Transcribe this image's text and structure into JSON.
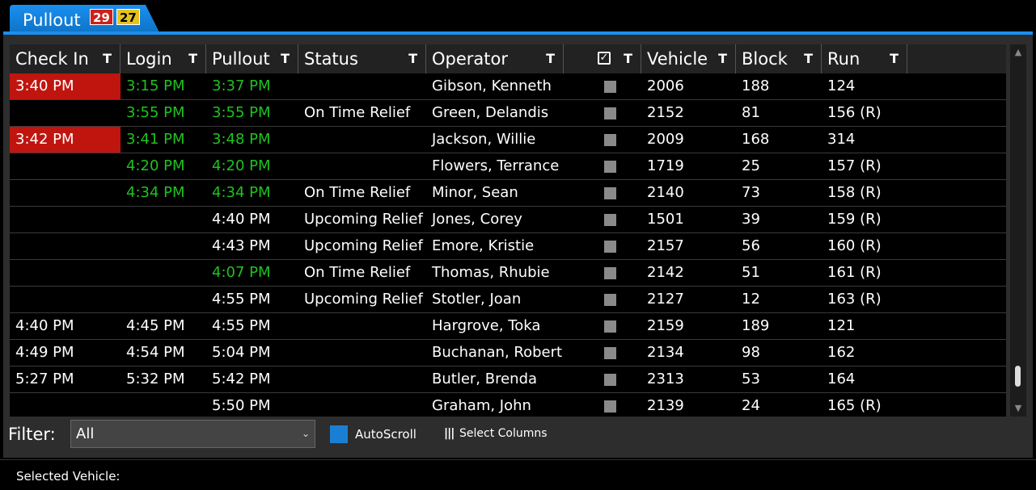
{
  "tab": {
    "label": "Pullout",
    "badge_red": "29",
    "badge_yellow": "27"
  },
  "columns": [
    {
      "key": "checkin",
      "label": "Check In",
      "width": 137
    },
    {
      "key": "login",
      "label": "Login",
      "width": 106
    },
    {
      "key": "pullout",
      "label": "Pullout",
      "width": 114
    },
    {
      "key": "status",
      "label": "Status",
      "width": 158
    },
    {
      "key": "operator",
      "label": "Operator",
      "width": 170
    },
    {
      "key": "check",
      "label": "",
      "width": 96
    },
    {
      "key": "vehicle",
      "label": "Vehicle",
      "width": 117
    },
    {
      "key": "block",
      "label": "Block",
      "width": 106
    },
    {
      "key": "run",
      "label": "Run",
      "width": 106
    }
  ],
  "rows": [
    {
      "checkin": "3:40 PM",
      "checkin_late": true,
      "login": "3:15 PM",
      "login_green": true,
      "pullout": "3:37 PM",
      "pullout_green": true,
      "status": "",
      "operator": "Gibson, Kenneth",
      "vehicle": "2006",
      "block": "188",
      "run": "124"
    },
    {
      "checkin": "",
      "checkin_late": false,
      "login": "3:55 PM",
      "login_green": true,
      "pullout": "3:55 PM",
      "pullout_green": true,
      "status": "On Time Relief",
      "operator": "Green, Delandis",
      "vehicle": "2152",
      "block": "81",
      "run": "156 (R)"
    },
    {
      "checkin": "3:42 PM",
      "checkin_late": true,
      "login": "3:41 PM",
      "login_green": true,
      "pullout": "3:48 PM",
      "pullout_green": true,
      "status": "",
      "operator": "Jackson, Willie",
      "vehicle": "2009",
      "block": "168",
      "run": "314"
    },
    {
      "checkin": "",
      "checkin_late": false,
      "login": "4:20 PM",
      "login_green": true,
      "pullout": "4:20 PM",
      "pullout_green": true,
      "status": "",
      "operator": "Flowers, Terrance",
      "vehicle": "1719",
      "block": "25",
      "run": "157 (R)"
    },
    {
      "checkin": "",
      "checkin_late": false,
      "login": "4:34 PM",
      "login_green": true,
      "pullout": "4:34 PM",
      "pullout_green": true,
      "status": "On Time Relief",
      "operator": "Minor, Sean",
      "vehicle": "2140",
      "block": "73",
      "run": "158 (R)"
    },
    {
      "checkin": "",
      "checkin_late": false,
      "login": "",
      "login_green": false,
      "pullout": "4:40 PM",
      "pullout_green": false,
      "status": "Upcoming Relief",
      "operator": "Jones, Corey",
      "vehicle": "1501",
      "block": "39",
      "run": "159 (R)"
    },
    {
      "checkin": "",
      "checkin_late": false,
      "login": "",
      "login_green": false,
      "pullout": "4:43 PM",
      "pullout_green": false,
      "status": "Upcoming Relief",
      "operator": "Emore, Kristie",
      "vehicle": "2157",
      "block": "56",
      "run": "160 (R)"
    },
    {
      "checkin": "",
      "checkin_late": false,
      "login": "",
      "login_green": false,
      "pullout": "4:07 PM",
      "pullout_green": true,
      "status": "On Time Relief",
      "operator": "Thomas, Rhubie",
      "vehicle": "2142",
      "block": "51",
      "run": "161 (R)"
    },
    {
      "checkin": "",
      "checkin_late": false,
      "login": "",
      "login_green": false,
      "pullout": "4:55 PM",
      "pullout_green": false,
      "status": "Upcoming Relief",
      "operator": "Stotler, Joan",
      "vehicle": "2127",
      "block": "12",
      "run": "163 (R)"
    },
    {
      "checkin": "4:40 PM",
      "checkin_late": false,
      "login": "4:45 PM",
      "login_green": false,
      "pullout": "4:55 PM",
      "pullout_green": false,
      "status": "",
      "operator": "Hargrove, Toka",
      "vehicle": "2159",
      "block": "189",
      "run": "121"
    },
    {
      "checkin": "4:49 PM",
      "checkin_late": false,
      "login": "4:54 PM",
      "login_green": false,
      "pullout": "5:04 PM",
      "pullout_green": false,
      "status": "",
      "operator": "Buchanan, Robert",
      "vehicle": "2134",
      "block": "98",
      "run": "162"
    },
    {
      "checkin": "5:27 PM",
      "checkin_late": false,
      "login": "5:32 PM",
      "login_green": false,
      "pullout": "5:42 PM",
      "pullout_green": false,
      "status": "",
      "operator": "Butler, Brenda",
      "vehicle": "2313",
      "block": "53",
      "run": "164"
    },
    {
      "checkin": "",
      "checkin_late": false,
      "login": "",
      "login_green": false,
      "pullout": "5:50 PM",
      "pullout_green": false,
      "status": "",
      "operator": "Graham, John",
      "vehicle": "2139",
      "block": "24",
      "run": "165 (R)"
    }
  ],
  "filter": {
    "label": "Filter:",
    "value": "All"
  },
  "autoscroll": {
    "label": "AutoScroll",
    "checked": true
  },
  "select_columns": {
    "label": "Select Columns"
  },
  "status_bar": {
    "selected_vehicle_label": "Selected Vehicle:"
  },
  "colors": {
    "late": "#c0150f",
    "green_text": "#1fc21f",
    "accent": "#1a8ff0"
  }
}
